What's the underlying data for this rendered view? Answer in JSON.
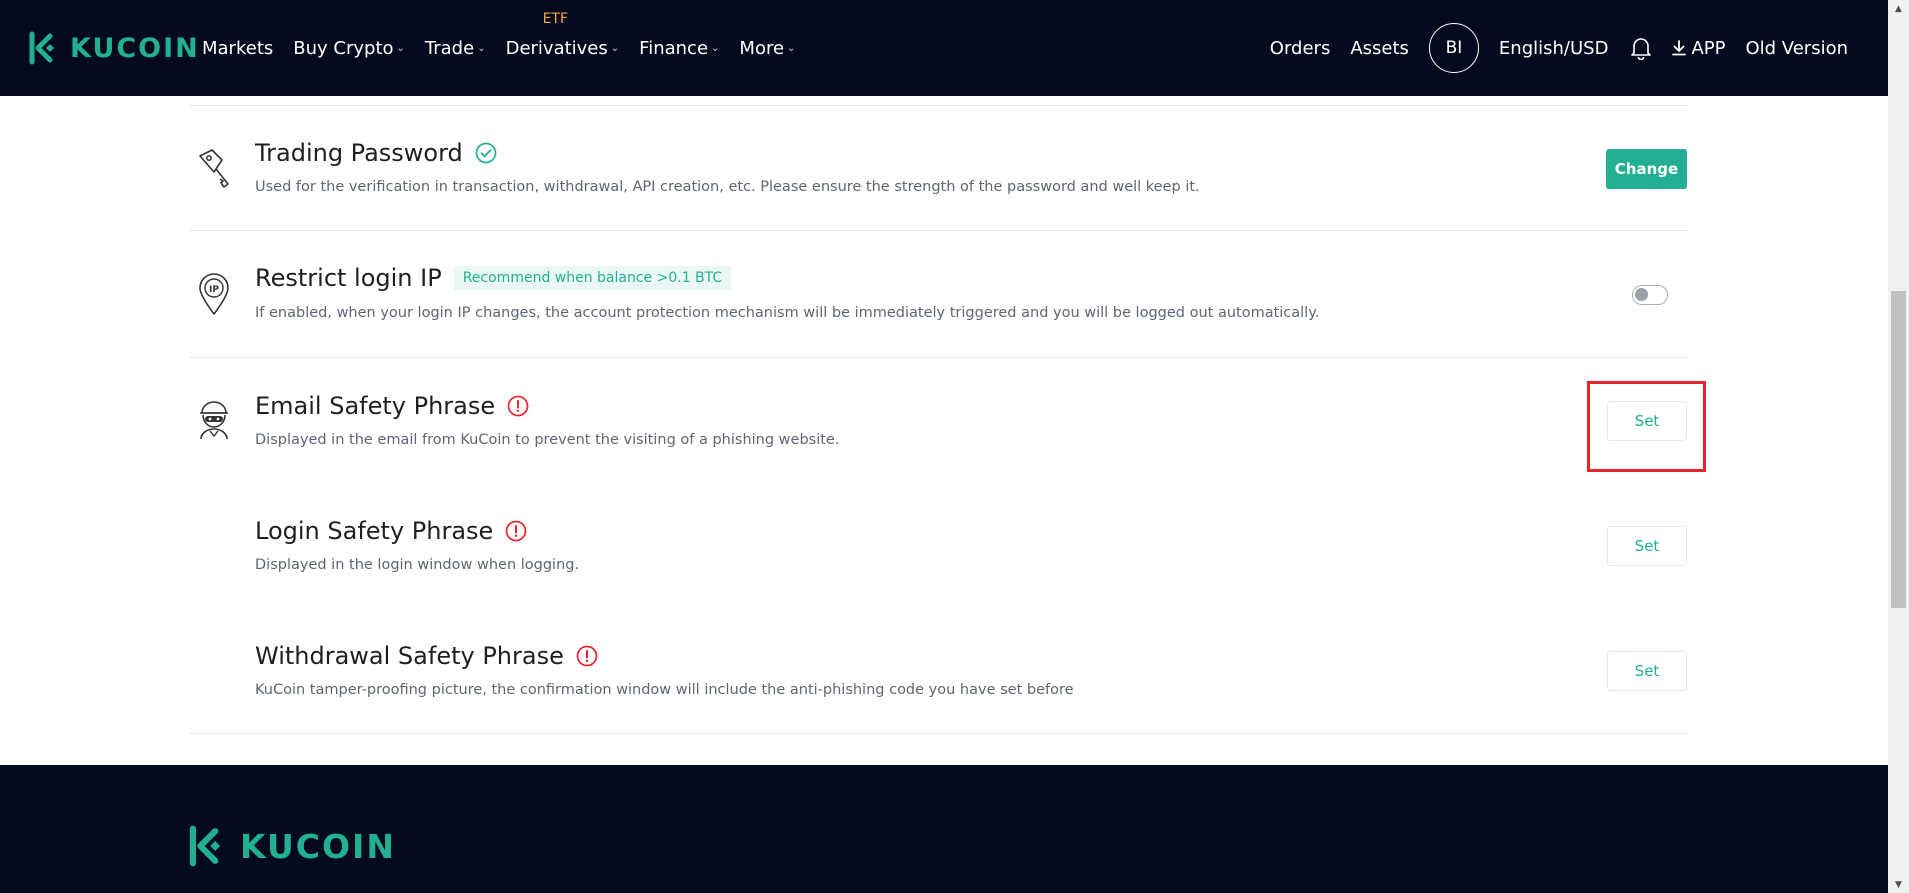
{
  "brand": {
    "name": "KUCOIN",
    "color": "#23af91"
  },
  "nav": {
    "items": [
      {
        "label": "Markets",
        "chevron": false
      },
      {
        "label": "Buy Crypto",
        "chevron": true
      },
      {
        "label": "Trade",
        "chevron": true
      },
      {
        "label": "Derivatives",
        "chevron": true,
        "tag": "ETF"
      },
      {
        "label": "Finance",
        "chevron": true
      },
      {
        "label": "More",
        "chevron": true
      }
    ],
    "right": {
      "orders": "Orders",
      "assets": "Assets",
      "avatar_initials": "BI",
      "language": "English/USD",
      "app": "APP",
      "old_version": "Old Version"
    }
  },
  "security": {
    "trading_password": {
      "title": "Trading Password",
      "status": "verified",
      "description": "Used for the verification in transaction, withdrawal, API creation, etc. Please ensure the strength of the password and well keep it.",
      "button": "Change"
    },
    "restrict_ip": {
      "title": "Restrict login IP",
      "badge": "Recommend when balance >0.1 BTC",
      "description": "If enabled, when your login IP changes, the account protection mechanism will be immediately triggered and you will be logged out automatically.",
      "enabled": false,
      "icon_text": "IP"
    },
    "email_phrase": {
      "title": "Email Safety Phrase",
      "status": "warning",
      "description": "Displayed in the email from KuCoin to prevent the visiting of a phishing website.",
      "button": "Set"
    },
    "login_phrase": {
      "title": "Login Safety Phrase",
      "status": "warning",
      "description": "Displayed in the login window when logging.",
      "button": "Set"
    },
    "withdrawal_phrase": {
      "title": "Withdrawal Safety Phrase",
      "status": "warning",
      "description": "KuCoin tamper-proofing picture, the confirmation window will include the anti-phishing code you have set before",
      "button": "Set"
    }
  },
  "colors": {
    "nav_bg": "#050b1e",
    "accent": "#23af91",
    "warning": "#e8232e",
    "etf_tag": "#f0a93a"
  }
}
